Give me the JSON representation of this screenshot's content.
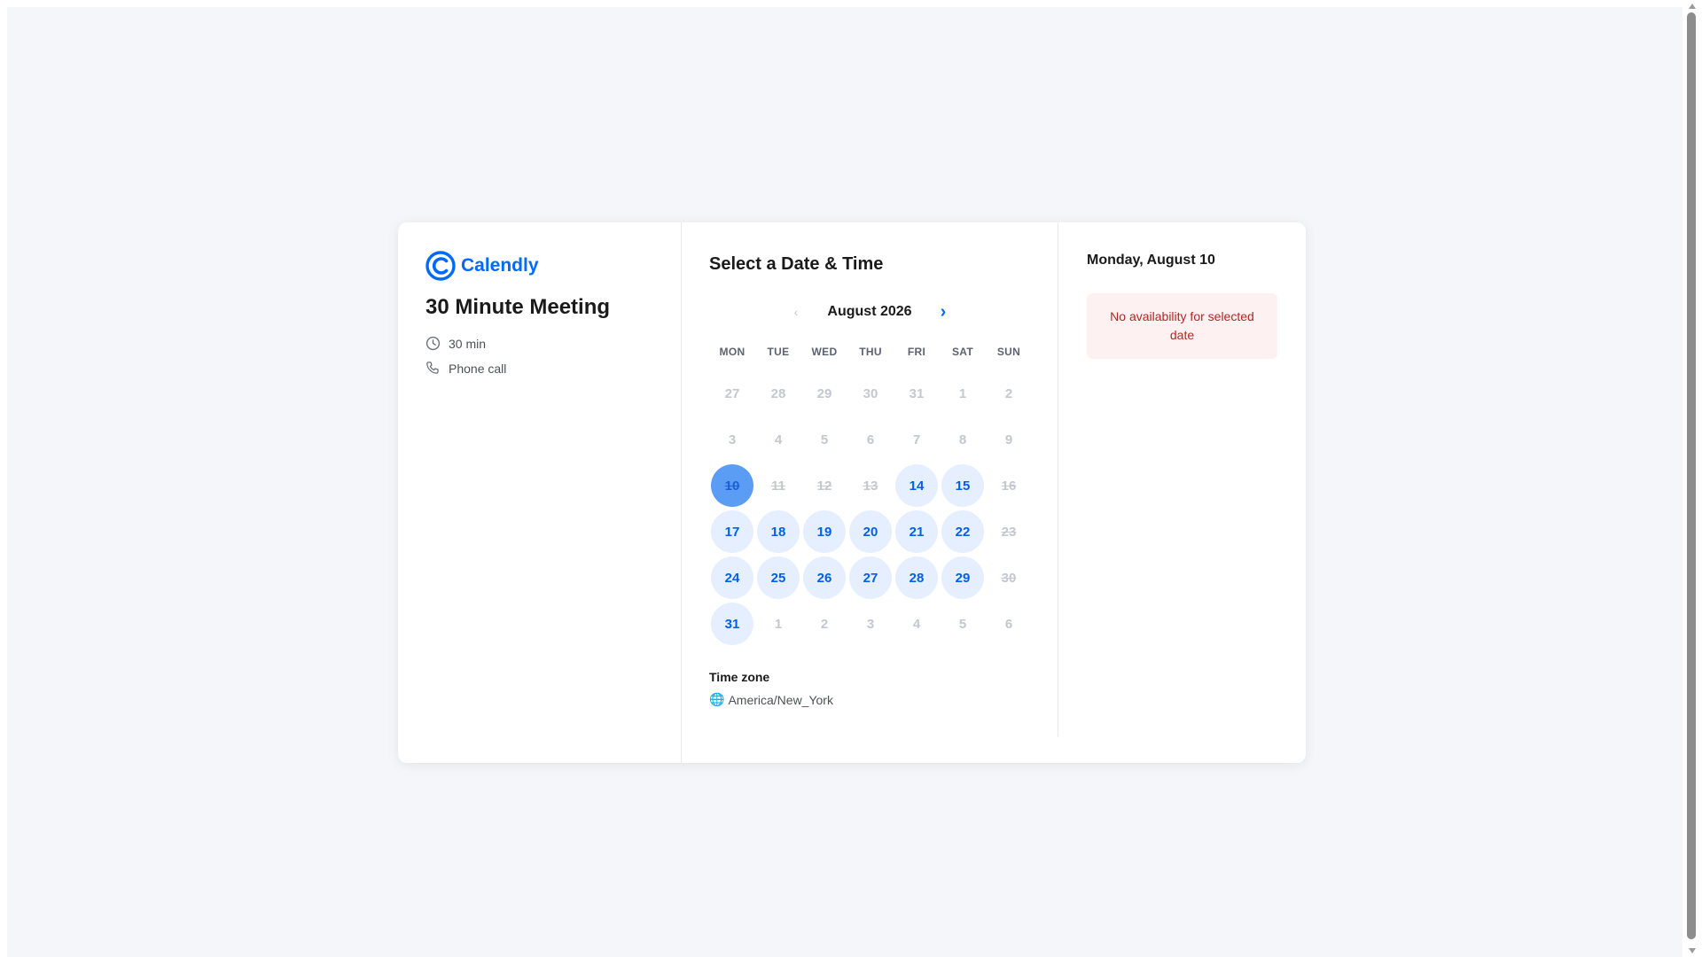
{
  "brand": {
    "name": "Calendly",
    "color": "#0069ff"
  },
  "event": {
    "title": "30 Minute Meeting",
    "duration": "30 min",
    "location": "Phone call",
    "duration_icon": "clock-icon",
    "location_icon": "phone-icon"
  },
  "calendar": {
    "heading": "Select a Date & Time",
    "month_label": "August 2026",
    "prev_icon": "‹",
    "next_icon": "›",
    "weekdays": [
      "MON",
      "TUE",
      "WED",
      "THU",
      "FRI",
      "SAT",
      "SUN"
    ],
    "weeks": [
      [
        {
          "label": "27",
          "state": "outside"
        },
        {
          "label": "28",
          "state": "outside"
        },
        {
          "label": "29",
          "state": "outside"
        },
        {
          "label": "30",
          "state": "outside"
        },
        {
          "label": "31",
          "state": "outside"
        },
        {
          "label": "1",
          "state": "outside"
        },
        {
          "label": "2",
          "state": "outside"
        }
      ],
      [
        {
          "label": "3",
          "state": "outside"
        },
        {
          "label": "4",
          "state": "outside"
        },
        {
          "label": "5",
          "state": "outside"
        },
        {
          "label": "6",
          "state": "outside"
        },
        {
          "label": "7",
          "state": "outside"
        },
        {
          "label": "8",
          "state": "outside"
        },
        {
          "label": "9",
          "state": "outside"
        }
      ],
      [
        {
          "label": "10",
          "state": "selected"
        },
        {
          "label": "11",
          "state": "unavailable"
        },
        {
          "label": "12",
          "state": "unavailable"
        },
        {
          "label": "13",
          "state": "unavailable"
        },
        {
          "label": "14",
          "state": "available"
        },
        {
          "label": "15",
          "state": "available"
        },
        {
          "label": "16",
          "state": "unavailable"
        }
      ],
      [
        {
          "label": "17",
          "state": "available"
        },
        {
          "label": "18",
          "state": "available"
        },
        {
          "label": "19",
          "state": "available"
        },
        {
          "label": "20",
          "state": "available"
        },
        {
          "label": "21",
          "state": "available"
        },
        {
          "label": "22",
          "state": "available"
        },
        {
          "label": "23",
          "state": "unavailable"
        }
      ],
      [
        {
          "label": "24",
          "state": "available"
        },
        {
          "label": "25",
          "state": "available"
        },
        {
          "label": "26",
          "state": "available"
        },
        {
          "label": "27",
          "state": "available"
        },
        {
          "label": "28",
          "state": "available"
        },
        {
          "label": "29",
          "state": "available"
        },
        {
          "label": "30",
          "state": "unavailable"
        }
      ],
      [
        {
          "label": "31",
          "state": "available"
        },
        {
          "label": "1",
          "state": "outside"
        },
        {
          "label": "2",
          "state": "outside"
        },
        {
          "label": "3",
          "state": "outside"
        },
        {
          "label": "4",
          "state": "outside"
        },
        {
          "label": "5",
          "state": "outside"
        },
        {
          "label": "6",
          "state": "outside"
        }
      ]
    ],
    "colors": {
      "available_bg": "#e6efff",
      "available_text": "#0060e6",
      "selected_bg": "#5b9cf5",
      "disabled_text": "#c3c7cf"
    }
  },
  "timezone": {
    "label": "Time zone",
    "icon": "🌐",
    "value": "America/New_York"
  },
  "availability": {
    "selected_date": "Monday, August 10",
    "message": "No availability for selected date"
  }
}
